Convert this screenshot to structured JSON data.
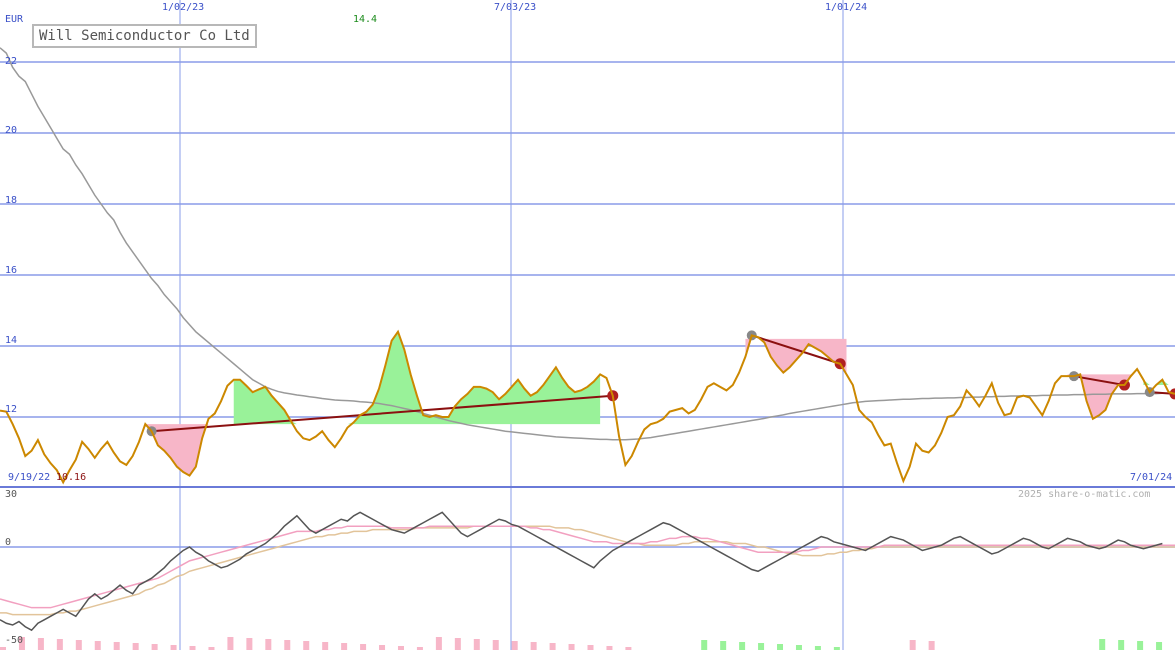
{
  "chart_data": {
    "type": "line",
    "title": "Will Semiconductor Co Ltd",
    "currency": "EUR",
    "colors": {
      "price": "#cc8800",
      "ma_long": "#999999",
      "gain_fill": "#99f299",
      "loss_fill": "#f7b6c8",
      "trend_line": "#8b1010",
      "grid": "#8a9ce8",
      "osc_main": "#555555",
      "osc_fast": "#f2a0c0",
      "osc_slow": "#e2c49a"
    },
    "x_tick_labels": [
      "1/02/23",
      "7/03/23",
      "1/01/24"
    ],
    "x_range": [
      "9/19/22",
      "7/01/24"
    ],
    "ylim": [
      10,
      23
    ],
    "y_ticks": [
      12,
      14,
      16,
      18,
      20,
      22
    ],
    "y_tick_labels": [
      "12",
      "14",
      "16",
      "18",
      "20",
      "22"
    ],
    "max_label": "14.4",
    "min_label": "10.16",
    "start_label": "9/19/22",
    "end_label": "7/01/24",
    "watermark": "2025 share-o-matic.com",
    "price": [
      12.18,
      12.15,
      11.8,
      11.4,
      10.9,
      11.05,
      11.35,
      10.95,
      10.7,
      10.5,
      10.16,
      10.5,
      10.8,
      11.3,
      11.1,
      10.85,
      11.1,
      11.3,
      11.0,
      10.75,
      10.65,
      10.9,
      11.3,
      11.8,
      11.6,
      11.2,
      11.05,
      10.85,
      10.6,
      10.45,
      10.35,
      10.6,
      11.4,
      11.95,
      12.1,
      12.45,
      12.88,
      13.05,
      13.05,
      12.88,
      12.7,
      12.78,
      12.85,
      12.6,
      12.4,
      12.2,
      11.9,
      11.6,
      11.4,
      11.35,
      11.45,
      11.6,
      11.35,
      11.15,
      11.4,
      11.7,
      11.85,
      12.05,
      12.15,
      12.35,
      12.8,
      13.45,
      14.15,
      14.4,
      13.9,
      13.2,
      12.6,
      12.05,
      12.0,
      12.05,
      12.0,
      12.0,
      12.3,
      12.5,
      12.65,
      12.85,
      12.85,
      12.8,
      12.7,
      12.5,
      12.65,
      12.85,
      13.05,
      12.8,
      12.6,
      12.7,
      12.9,
      13.15,
      13.4,
      13.1,
      12.85,
      12.7,
      12.75,
      12.85,
      13.0,
      13.2,
      13.1,
      12.6,
      11.45,
      10.65,
      10.9,
      11.3,
      11.65,
      11.8,
      11.85,
      11.95,
      12.15,
      12.2,
      12.25,
      12.1,
      12.2,
      12.5,
      12.85,
      12.95,
      12.85,
      12.75,
      12.9,
      13.25,
      13.7,
      14.3,
      14.25,
      14.1,
      13.7,
      13.45,
      13.25,
      13.4,
      13.6,
      13.8,
      14.05,
      13.95,
      13.85,
      13.7,
      13.55,
      13.5,
      13.2,
      12.9,
      12.2,
      12.0,
      11.85,
      11.5,
      11.2,
      11.25,
      10.7,
      10.2,
      10.6,
      11.25,
      11.05,
      11.0,
      11.2,
      11.55,
      12.0,
      12.05,
      12.3,
      12.75,
      12.55,
      12.3,
      12.6,
      12.95,
      12.4,
      12.05,
      12.1,
      12.55,
      12.6,
      12.55,
      12.3,
      12.05,
      12.45,
      12.95,
      13.15,
      13.15,
      13.15,
      13.2,
      12.45,
      11.95,
      12.05,
      12.2,
      12.65,
      12.9,
      12.9,
      13.15,
      13.35,
      13.05,
      12.7,
      12.9,
      13.05,
      12.7,
      12.65
    ],
    "ma_long": [
      22.4,
      22.25,
      21.85,
      21.6,
      21.45,
      21.1,
      20.75,
      20.45,
      20.15,
      19.85,
      19.55,
      19.4,
      19.1,
      18.85,
      18.55,
      18.25,
      18.0,
      17.75,
      17.55,
      17.2,
      16.9,
      16.65,
      16.4,
      16.15,
      15.9,
      15.7,
      15.45,
      15.25,
      15.05,
      14.8,
      14.6,
      14.4,
      14.25,
      14.1,
      13.95,
      13.8,
      13.65,
      13.5,
      13.35,
      13.2,
      13.05,
      12.95,
      12.85,
      12.78,
      12.72,
      12.68,
      12.65,
      12.62,
      12.6,
      12.57,
      12.55,
      12.52,
      12.5,
      12.48,
      12.47,
      12.46,
      12.45,
      12.43,
      12.42,
      12.4,
      12.38,
      12.35,
      12.32,
      12.28,
      12.24,
      12.2,
      12.15,
      12.1,
      12.05,
      12.0,
      11.95,
      11.9,
      11.86,
      11.82,
      11.78,
      11.75,
      11.72,
      11.69,
      11.66,
      11.63,
      11.6,
      11.58,
      11.56,
      11.54,
      11.52,
      11.5,
      11.48,
      11.46,
      11.44,
      11.43,
      11.42,
      11.41,
      11.4,
      11.39,
      11.38,
      11.37,
      11.37,
      11.36,
      11.36,
      11.36,
      11.37,
      11.38,
      11.4,
      11.42,
      11.45,
      11.48,
      11.51,
      11.54,
      11.57,
      11.6,
      11.63,
      11.66,
      11.69,
      11.72,
      11.75,
      11.78,
      11.81,
      11.84,
      11.87,
      11.9,
      11.93,
      11.96,
      12.0,
      12.03,
      12.06,
      12.1,
      12.13,
      12.16,
      12.19,
      12.22,
      12.25,
      12.28,
      12.31,
      12.34,
      12.37,
      12.4,
      12.42,
      12.44,
      12.45,
      12.46,
      12.47,
      12.48,
      12.49,
      12.5,
      12.5,
      12.51,
      12.52,
      12.52,
      12.53,
      12.53,
      12.54,
      12.54,
      12.55,
      12.55,
      12.56,
      12.56,
      12.57,
      12.57,
      12.58,
      12.58,
      12.59,
      12.59,
      12.6,
      12.6,
      12.6,
      12.61,
      12.61,
      12.62,
      12.62,
      12.62,
      12.63,
      12.63,
      12.63,
      12.64,
      12.64,
      12.64,
      12.65,
      12.65,
      12.65,
      12.65,
      12.66,
      12.66,
      12.66,
      12.66,
      12.67
    ],
    "oscillator": {
      "ylim": [
        -50,
        30
      ],
      "y_tick_labels": [
        "30",
        "0",
        "-50"
      ],
      "main": [
        -42,
        -44,
        -45,
        -43,
        -46,
        -48,
        -44,
        -42,
        -40,
        -38,
        -36,
        -38,
        -40,
        -35,
        -30,
        -27,
        -30,
        -28,
        -25,
        -22,
        -25,
        -27,
        -22,
        -20,
        -18,
        -15,
        -12,
        -8,
        -5,
        -2,
        0,
        -3,
        -5,
        -8,
        -10,
        -12,
        -11,
        -9,
        -7,
        -4,
        -2,
        0,
        2,
        5,
        8,
        12,
        15,
        18,
        14,
        10,
        8,
        10,
        12,
        14,
        16,
        15,
        18,
        20,
        18,
        16,
        14,
        12,
        10,
        9,
        8,
        10,
        12,
        14,
        16,
        18,
        20,
        16,
        12,
        8,
        6,
        8,
        10,
        12,
        14,
        16,
        15,
        13,
        12,
        10,
        8,
        6,
        4,
        2,
        0,
        -2,
        -4,
        -6,
        -8,
        -10,
        -12,
        -8,
        -5,
        -2,
        0,
        2,
        4,
        6,
        8,
        10,
        12,
        14,
        13,
        11,
        9,
        7,
        5,
        3,
        1,
        -1,
        -3,
        -5,
        -7,
        -9,
        -11,
        -13,
        -14,
        -12,
        -10,
        -8,
        -6,
        -4,
        -2,
        0,
        2,
        4,
        6,
        5,
        3,
        2,
        1,
        0,
        -1,
        -2,
        0,
        2,
        4,
        6,
        5,
        4,
        2,
        0,
        -2,
        -1,
        0,
        1,
        3,
        5,
        6,
        4,
        2,
        0,
        -2,
        -4,
        -3,
        -1,
        1,
        3,
        5,
        4,
        2,
        0,
        -1,
        1,
        3,
        5,
        4,
        3,
        1,
        0,
        -1,
        0,
        2,
        4,
        3,
        1,
        0,
        -1,
        0,
        1,
        2
      ],
      "fast": [
        -30,
        -31,
        -32,
        -33,
        -34,
        -35,
        -35,
        -35,
        -35,
        -34,
        -33,
        -32,
        -31,
        -30,
        -29,
        -28,
        -27,
        -26,
        -25,
        -24,
        -23,
        -22,
        -21,
        -20,
        -19,
        -18,
        -16,
        -14,
        -12,
        -10,
        -8,
        -7,
        -6,
        -5,
        -4,
        -3,
        -2,
        -1,
        0,
        1,
        2,
        3,
        4,
        5,
        6,
        7,
        8,
        9,
        9,
        9,
        9,
        10,
        10,
        11,
        11,
        12,
        12,
        12,
        12,
        12,
        12,
        12,
        11,
        11,
        11,
        11,
        11,
        11,
        12,
        12,
        12,
        12,
        12,
        12,
        12,
        12,
        12,
        12,
        12,
        12,
        12,
        12,
        12,
        12,
        11,
        11,
        10,
        10,
        9,
        8,
        7,
        6,
        5,
        4,
        3,
        3,
        3,
        2,
        2,
        2,
        2,
        2,
        2,
        3,
        3,
        4,
        5,
        5,
        6,
        6,
        6,
        5,
        5,
        4,
        3,
        2,
        1,
        0,
        -1,
        -2,
        -3,
        -3,
        -3,
        -3,
        -3,
        -3,
        -3,
        -2,
        -2,
        -1,
        0,
        0,
        0,
        0,
        0,
        0,
        0,
        0,
        0,
        0,
        1,
        1,
        1,
        1,
        1,
        1,
        1,
        1,
        1,
        1,
        1,
        1,
        1,
        1,
        1,
        1,
        1,
        1,
        1,
        1,
        1,
        1,
        1,
        1,
        1,
        1,
        1,
        1,
        1,
        1,
        1,
        1,
        1,
        1,
        1,
        1,
        1,
        1,
        1,
        1,
        1,
        1,
        1,
        1,
        1,
        1,
        1,
        1,
        1,
        1,
        1
      ],
      "slow": [
        -38,
        -38,
        -39,
        -39,
        -39,
        -39,
        -39,
        -39,
        -39,
        -38,
        -38,
        -37,
        -37,
        -36,
        -35,
        -34,
        -33,
        -32,
        -31,
        -30,
        -29,
        -28,
        -27,
        -25,
        -24,
        -22,
        -21,
        -19,
        -17,
        -16,
        -14,
        -13,
        -12,
        -11,
        -10,
        -9,
        -8,
        -7,
        -6,
        -5,
        -4,
        -3,
        -2,
        -1,
        0,
        1,
        2,
        3,
        4,
        5,
        6,
        6,
        7,
        7,
        8,
        8,
        9,
        9,
        9,
        10,
        10,
        10,
        10,
        10,
        10,
        10,
        11,
        11,
        11,
        11,
        11,
        11,
        11,
        11,
        11,
        12,
        12,
        12,
        12,
        12,
        12,
        12,
        12,
        12,
        12,
        12,
        12,
        12,
        11,
        11,
        11,
        10,
        10,
        9,
        8,
        7,
        6,
        5,
        4,
        3,
        2,
        2,
        1,
        1,
        1,
        1,
        1,
        1,
        2,
        2,
        3,
        3,
        3,
        3,
        3,
        3,
        2,
        2,
        2,
        1,
        0,
        0,
        -1,
        -2,
        -3,
        -4,
        -4,
        -5,
        -5,
        -5,
        -5,
        -4,
        -4,
        -3,
        -3,
        -2,
        -2,
        -1,
        -1,
        0,
        0,
        0,
        0,
        0,
        0,
        0,
        0,
        0,
        0,
        0,
        0,
        0,
        0,
        0,
        0,
        0,
        0,
        0,
        0,
        0,
        0,
        0,
        0,
        0,
        0,
        0,
        0,
        0,
        0,
        0,
        0,
        0,
        0,
        0,
        0,
        0,
        0,
        0,
        0,
        0,
        0,
        0,
        0,
        0,
        0,
        0,
        0,
        0,
        0,
        0,
        0,
        0,
        0
      ]
    }
  }
}
